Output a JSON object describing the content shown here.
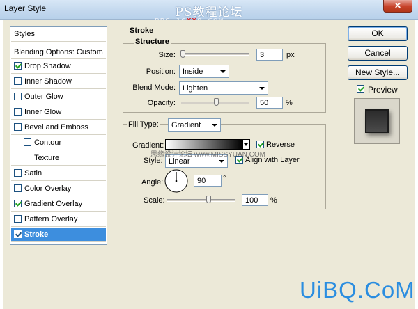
{
  "window": {
    "title": "Layer Style",
    "close_glyph": "✕",
    "watermark_top": "PS教程论坛",
    "watermark_url_a": "BBS.16",
    "watermark_url_b": "XX",
    "watermark_url_c": "8.COM"
  },
  "styles_panel": {
    "header": "Styles",
    "blending": "Blending Options: Custom",
    "items": [
      {
        "label": "Drop Shadow",
        "checked": true
      },
      {
        "label": "Inner Shadow",
        "checked": false
      },
      {
        "label": "Outer Glow",
        "checked": false
      },
      {
        "label": "Inner Glow",
        "checked": false
      },
      {
        "label": "Bevel and Emboss",
        "checked": false
      },
      {
        "label": "Contour",
        "checked": false
      },
      {
        "label": "Texture",
        "checked": false
      },
      {
        "label": "Satin",
        "checked": false
      },
      {
        "label": "Color Overlay",
        "checked": false
      },
      {
        "label": "Gradient Overlay",
        "checked": true
      },
      {
        "label": "Pattern Overlay",
        "checked": false
      },
      {
        "label": "Stroke",
        "checked": true,
        "selected": true
      }
    ]
  },
  "stroke": {
    "section_title": "Stroke",
    "structure_title": "Structure",
    "size_label": "Size:",
    "size_value": "3",
    "size_unit": "px",
    "position_label": "Position:",
    "position_value": "Inside",
    "blend_label": "Blend Mode:",
    "blend_value": "Lighten",
    "opacity_label": "Opacity:",
    "opacity_value": "50",
    "opacity_unit": "%",
    "fill_type_label": "Fill Type:",
    "fill_type_value": "Gradient",
    "gradient_label": "Gradient:",
    "reverse_label": "Reverse",
    "reverse_checked": true,
    "style_label": "Style:",
    "style_value": "Linear",
    "align_label": "Align with Layer",
    "align_checked": true,
    "angle_label": "Angle:",
    "angle_value": "90",
    "angle_unit": "°",
    "scale_label": "Scale:",
    "scale_value": "100",
    "scale_unit": "%"
  },
  "buttons": {
    "ok": "OK",
    "cancel": "Cancel",
    "new_style": "New Style...",
    "preview_label": "Preview",
    "preview_checked": true
  },
  "watermarks": {
    "cn_site": "思缘设计论坛  www.MISSYUAN.COM",
    "brand": "UiBQ.CoM"
  },
  "colors": {
    "selection": "#3d8ede",
    "dialog_bg": "#ece9d8",
    "brand": "#2a8de0"
  }
}
